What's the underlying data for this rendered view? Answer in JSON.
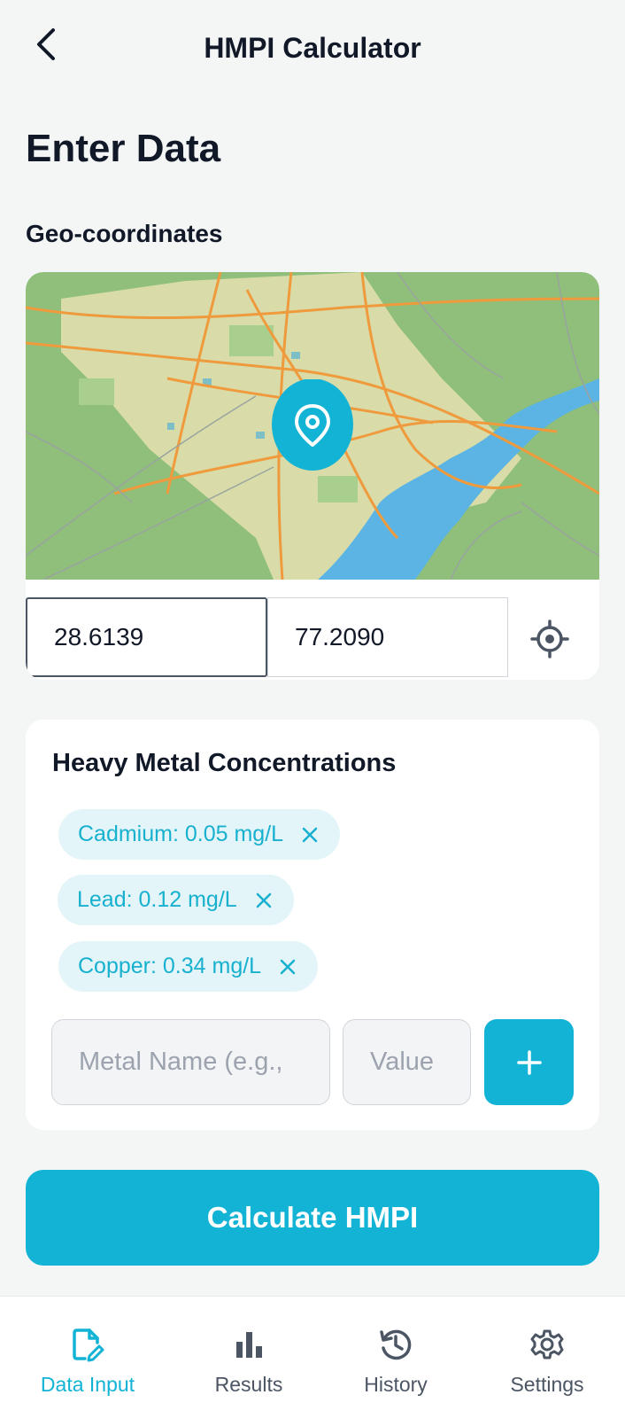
{
  "header": {
    "title": "HMPI Calculator",
    "back_icon": "chevron-left-icon"
  },
  "page_title": "Enter Data",
  "geo": {
    "label": "Geo-coordinates",
    "latitude": "28.6139",
    "longitude": "77.2090",
    "pin_icon": "map-pin-icon",
    "locate_icon": "crosshair-icon"
  },
  "metals": {
    "title": "Heavy Metal Concentrations",
    "chips": [
      {
        "label": "Cadmium: 0.05 mg/L"
      },
      {
        "label": "Lead: 0.12 mg/L"
      },
      {
        "label": "Copper: 0.34 mg/L"
      }
    ],
    "name_placeholder": "Metal Name (e.g.,",
    "value_placeholder": "Value",
    "add_label": "+"
  },
  "calculate_label": "Calculate HMPI",
  "nav": {
    "items": [
      {
        "label": "Data Input",
        "icon": "file-edit-icon",
        "active": true
      },
      {
        "label": "Results",
        "icon": "bar-chart-icon",
        "active": false
      },
      {
        "label": "History",
        "icon": "history-icon",
        "active": false
      },
      {
        "label": "Settings",
        "icon": "gear-icon",
        "active": false
      }
    ]
  },
  "colors": {
    "accent": "#13b3d6",
    "chip_bg": "#e3f5f8",
    "background": "#f4f6f6",
    "text": "#111827",
    "muted": "#4b5563"
  }
}
